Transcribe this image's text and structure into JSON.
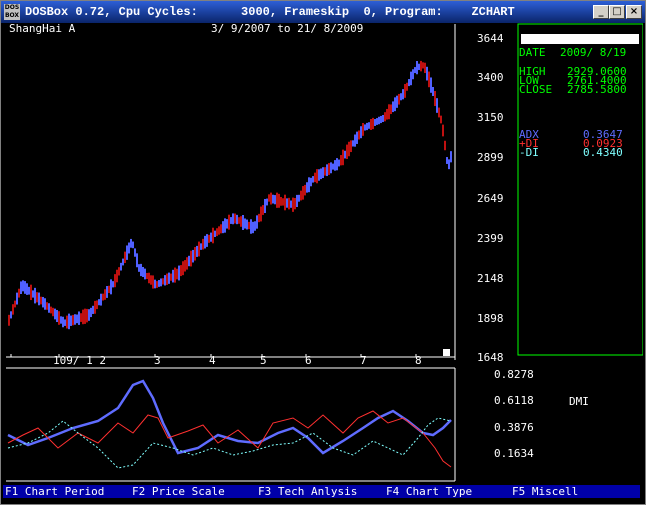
{
  "window": {
    "app_icon_text": "DOS BOX",
    "title": "DOSBox 0.72, Cpu Cycles:      3000, Frameskip  0, Program:    ZCHART",
    "buttons": {
      "minimize": "_",
      "maximize": "□",
      "close": "×"
    }
  },
  "chart": {
    "symbol": "ShangHai A",
    "range": "3/ 9/2007 to 21/ 8/2009",
    "price_axis": [
      "3644",
      "3400",
      "3150",
      "2899",
      "2649",
      "2399",
      "2148",
      "1898",
      "1648"
    ],
    "month_axis": [
      "109/ 1 2",
      "3",
      "4",
      "5",
      "6",
      "7",
      "8"
    ]
  },
  "info_panel": {
    "date_label": "DATE",
    "date_value": "2009/ 8/19",
    "high_label": "HIGH",
    "high_value": "2929.0600",
    "low_label": "LOW",
    "low_value": "2761.4000",
    "close_label": "CLOSE",
    "close_value": "2785.5800",
    "adx_label": "ADX",
    "adx_value": "0.3647",
    "pdi_label": "+DI",
    "pdi_value": "0.0923",
    "mdi_label": "-DI",
    "mdi_value": "0.4340"
  },
  "indicator": {
    "name": "DMI",
    "axis": [
      "0.8278",
      "0.6118",
      "0.3876",
      "0.1634"
    ]
  },
  "function_keys": [
    {
      "label": "F1 Chart Period"
    },
    {
      "label": "F2 Price Scale"
    },
    {
      "label": "F3 Tech Anlysis"
    },
    {
      "label": "F4 Chart Type"
    },
    {
      "label": "F5 Miscell"
    }
  ],
  "colors": {
    "adx": "#5f6cff",
    "pdi": "#ff3030",
    "mdi": "#7fffff",
    "up": "#c01010",
    "down": "#5060ff",
    "panel_border": "#00ff00"
  }
}
